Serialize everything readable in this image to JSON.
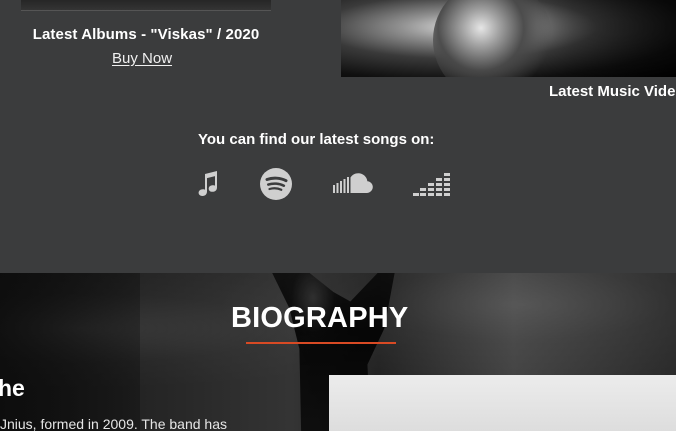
{
  "album": {
    "title": "Latest Albums - \"Viskas\" / 2020",
    "buy_label": "Buy Now"
  },
  "video": {
    "caption": "Latest Music Vide"
  },
  "streaming": {
    "heading": "You can find our latest songs on:",
    "platforms": [
      {
        "icon": "music-note-icon"
      },
      {
        "icon": "spotify-icon"
      },
      {
        "icon": "soundcloud-icon"
      },
      {
        "icon": "deezer-icon"
      }
    ]
  },
  "biography": {
    "title": "BIOGRAPHY",
    "subheading": "he",
    "text": "Jnius, formed in 2009. The band has",
    "accent_color": "#d84a24"
  }
}
